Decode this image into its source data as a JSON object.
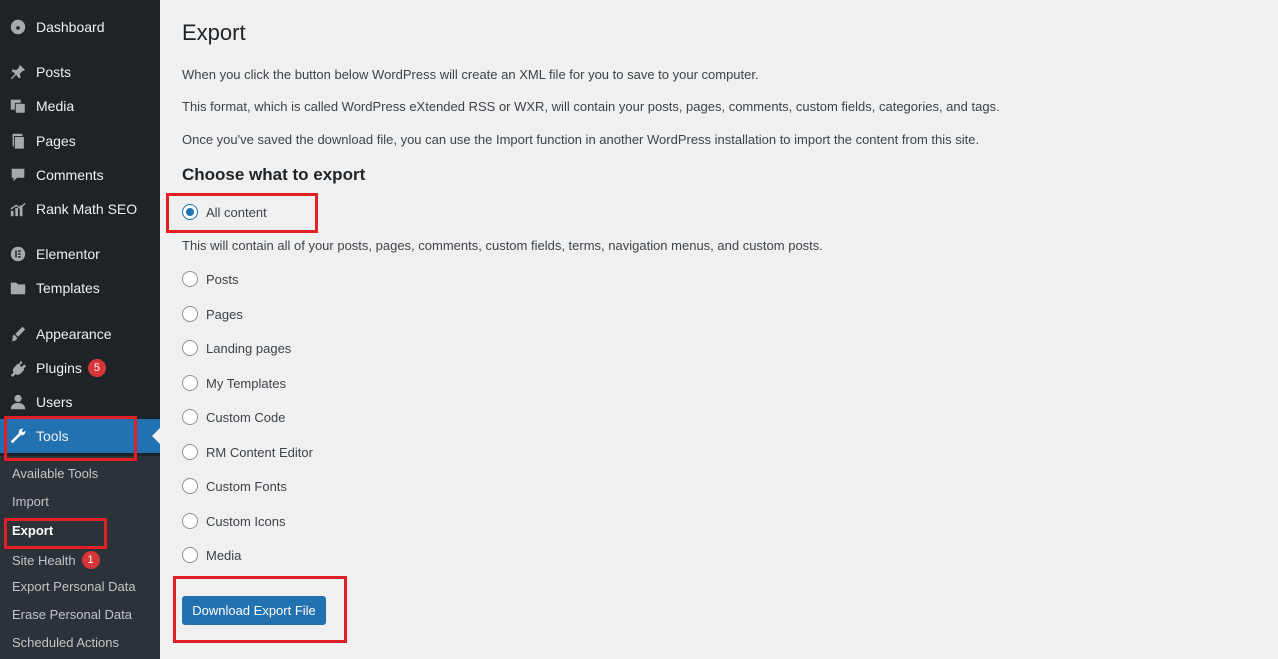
{
  "sidebar": {
    "items": [
      {
        "label": "Dashboard",
        "icon": "dashboard-icon"
      },
      {
        "label": "Posts",
        "icon": "pin-icon"
      },
      {
        "label": "Media",
        "icon": "media-icon"
      },
      {
        "label": "Pages",
        "icon": "pages-icon"
      },
      {
        "label": "Comments",
        "icon": "comment-icon"
      },
      {
        "label": "Rank Math SEO",
        "icon": "chart-icon"
      },
      {
        "label": "Elementor",
        "icon": "elementor-icon"
      },
      {
        "label": "Templates",
        "icon": "folder-icon"
      },
      {
        "label": "Appearance",
        "icon": "brush-icon"
      },
      {
        "label": "Plugins",
        "icon": "plugin-icon",
        "badge": "5"
      },
      {
        "label": "Users",
        "icon": "user-icon"
      },
      {
        "label": "Tools",
        "icon": "wrench-icon"
      }
    ],
    "submenu": [
      {
        "label": "Available Tools"
      },
      {
        "label": "Import"
      },
      {
        "label": "Export"
      },
      {
        "label": "Site Health",
        "badge": "1"
      },
      {
        "label": "Export Personal Data"
      },
      {
        "label": "Erase Personal Data"
      },
      {
        "label": "Scheduled Actions"
      }
    ]
  },
  "main": {
    "title": "Export",
    "paragraphs": [
      "When you click the button below WordPress will create an XML file for you to save to your computer.",
      "This format, which is called WordPress eXtended RSS or WXR, will contain your posts, pages, comments, custom fields, categories, and tags.",
      "Once you've saved the download file, you can use the Import function in another WordPress installation to import the content from this site."
    ],
    "heading": "Choose what to export",
    "options": [
      {
        "label": "All content",
        "checked": true
      },
      {
        "label": "Posts",
        "checked": false
      },
      {
        "label": "Pages",
        "checked": false
      },
      {
        "label": "Landing pages",
        "checked": false
      },
      {
        "label": "My Templates",
        "checked": false
      },
      {
        "label": "Custom Code",
        "checked": false
      },
      {
        "label": "RM Content Editor",
        "checked": false
      },
      {
        "label": "Custom Fonts",
        "checked": false
      },
      {
        "label": "Custom Icons",
        "checked": false
      },
      {
        "label": "Media",
        "checked": false
      }
    ],
    "all_content_desc": "This will contain all of your posts, pages, comments, custom fields, terms, navigation menus, and custom posts.",
    "download_label": "Download Export File"
  },
  "colors": {
    "sidebar_bg": "#1d2327",
    "accent": "#2271b1",
    "highlight": "#e31e25",
    "badge": "#d63638"
  }
}
